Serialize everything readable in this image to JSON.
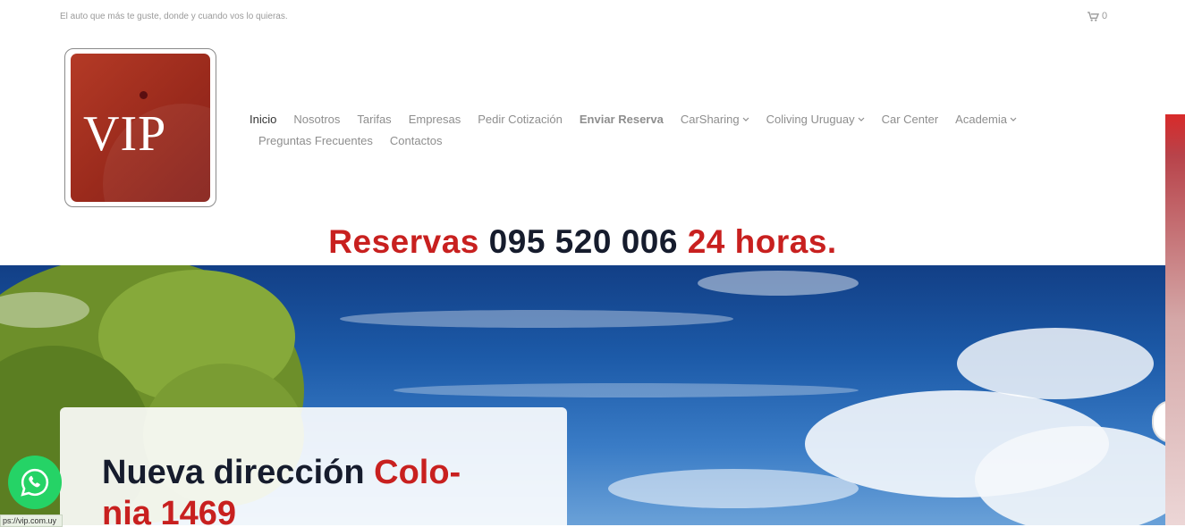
{
  "topbar": {
    "tagline": "El auto que más te guste, donde y cuando vos lo quieras.",
    "cart_count": "0"
  },
  "logo": {
    "text": "VIP"
  },
  "nav": {
    "row1": [
      {
        "label": "Inicio",
        "active": true
      },
      {
        "label": "Nosotros"
      },
      {
        "label": "Tarifas"
      },
      {
        "label": "Empresas"
      },
      {
        "label": "Pedir Cotización"
      },
      {
        "label": "Enviar Reserva",
        "bold": true
      },
      {
        "label": "CarSharing",
        "dropdown": true
      },
      {
        "label": "Coliving Uruguay",
        "dropdown": true
      },
      {
        "label": "Car Center"
      },
      {
        "label": "Academia",
        "dropdown": true
      }
    ],
    "row2": [
      {
        "label": "Preguntas Frecuentes"
      },
      {
        "label": "Contactos"
      }
    ]
  },
  "banner": {
    "part1": "Reservas",
    "phone": "095 520 006",
    "part2": "24 horas."
  },
  "hero": {
    "card_title_dark": "Nueva dirección",
    "card_title_red": "Colo-\nnia 1469"
  },
  "statusbar": {
    "url": "ps://vip.com.uy"
  },
  "colors": {
    "accent_red": "#c8201f",
    "dark_text": "#161c2d",
    "whatsapp_green": "#25d366"
  }
}
